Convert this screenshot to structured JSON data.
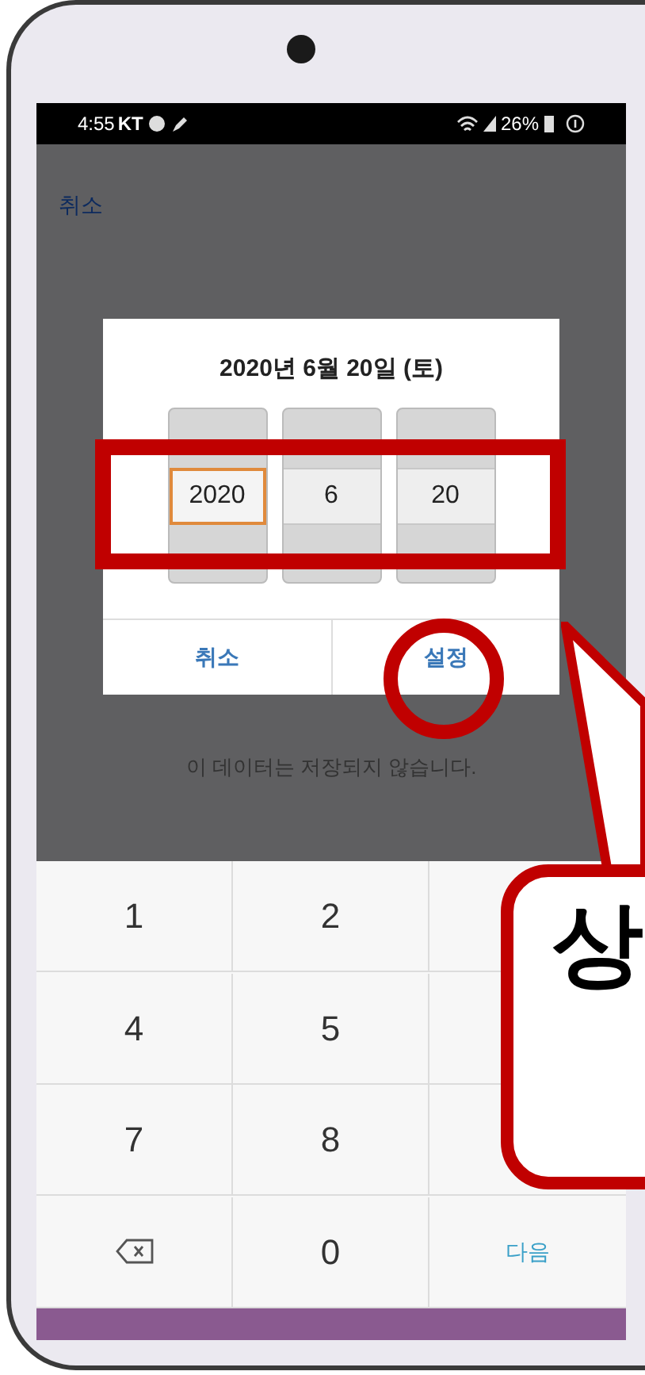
{
  "status_bar": {
    "time": "4:55",
    "carrier": "KT",
    "battery": "26%"
  },
  "top_bar": {
    "cancel": "취소"
  },
  "dialog": {
    "title": "2020년 6월 20일 (토)",
    "pickers": [
      {
        "value": "2020",
        "focused": true
      },
      {
        "value": "6",
        "focused": false
      },
      {
        "value": "20",
        "focused": false
      }
    ],
    "buttons": [
      {
        "label": "취소"
      },
      {
        "label": "설정"
      }
    ]
  },
  "message": "이 데이터는 저장되지 않습니다.",
  "keypad": [
    {
      "kind": "digit",
      "label": "1"
    },
    {
      "kind": "digit",
      "label": "2"
    },
    {
      "kind": "covered"
    },
    {
      "kind": "digit",
      "label": "4"
    },
    {
      "kind": "digit",
      "label": "5"
    },
    {
      "kind": "covered"
    },
    {
      "kind": "digit",
      "label": "7"
    },
    {
      "kind": "digit",
      "label": "8"
    },
    {
      "kind": "covered"
    },
    {
      "kind": "backspace"
    },
    {
      "kind": "digit",
      "label": "0"
    },
    {
      "kind": "action",
      "label": "다음"
    }
  ],
  "annotation": {
    "callout_text": "상"
  }
}
